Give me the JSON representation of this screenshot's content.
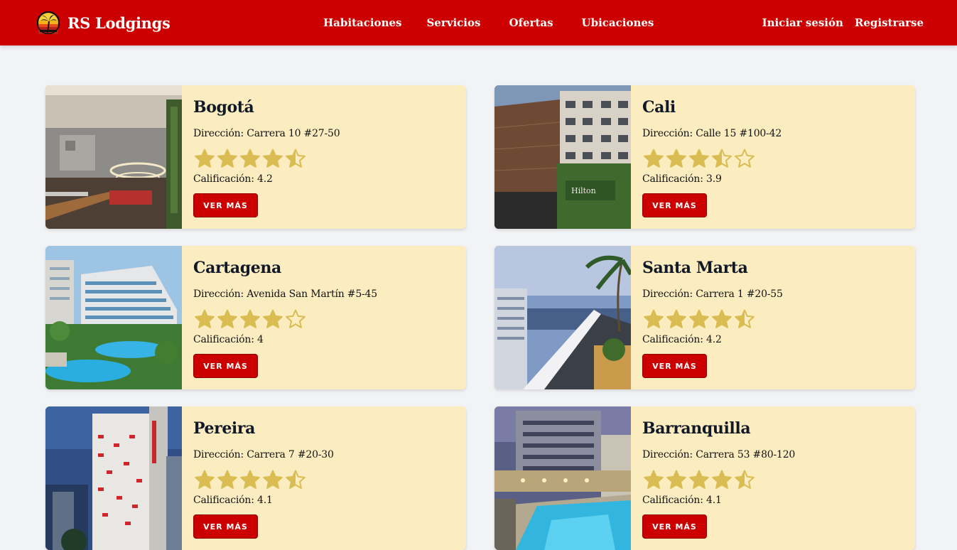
{
  "header": {
    "brand": "RS Lodgings",
    "nav": [
      "Habitaciones",
      "Servicios",
      "Ofertas",
      "Ubicaciones"
    ],
    "login": "Iniciar sesión",
    "register": "Registrarse"
  },
  "colors": {
    "brand_red": "#cc0000",
    "card_bg": "#fcedc0",
    "star": "#d9bc52",
    "page_bg": "#f2f3f5"
  },
  "hotels": [
    {
      "city": "Bogotá",
      "address": "Dirección: Carrera 10 #27-50",
      "rating_text": "Calificación: 4.2",
      "rating": 4.2,
      "stars_shown": 4.5,
      "button": "VER MÁS",
      "image": "hotel-lobby-interior-photo"
    },
    {
      "city": "Cali",
      "address": "Dirección: Calle 15 #100-42",
      "rating_text": "Calificación: 3.9",
      "rating": 3.9,
      "stars_shown": 3.5,
      "button": "VER MÁS",
      "image": "hotel-building-facade-photo"
    },
    {
      "city": "Cartagena",
      "address": "Dirección: Avenida San Martín #5-45",
      "rating_text": "Calificación: 4",
      "rating": 4,
      "stars_shown": 4,
      "button": "VER MÁS",
      "image": "beach-resort-pool-photo"
    },
    {
      "city": "Santa Marta",
      "address": "Dirección: Carrera 1 #20-55",
      "rating_text": "Calificación: 4.2",
      "rating": 4.2,
      "stars_shown": 4.5,
      "button": "VER MÁS",
      "image": "rooftop-bay-view-photo"
    },
    {
      "city": "Pereira",
      "address": "Dirección: Carrera 7 #20-30",
      "rating_text": "Calificación: 4.1",
      "rating": 4.1,
      "stars_shown": 4.5,
      "button": "VER MÁS",
      "image": "hotel-tower-night-photo"
    },
    {
      "city": "Barranquilla",
      "address": "Dirección: Carrera 53 #80-120",
      "rating_text": "Calificación: 4.1",
      "rating": 4.1,
      "stars_shown": 4.5,
      "button": "VER MÁS",
      "image": "rooftop-pool-dusk-photo"
    }
  ]
}
